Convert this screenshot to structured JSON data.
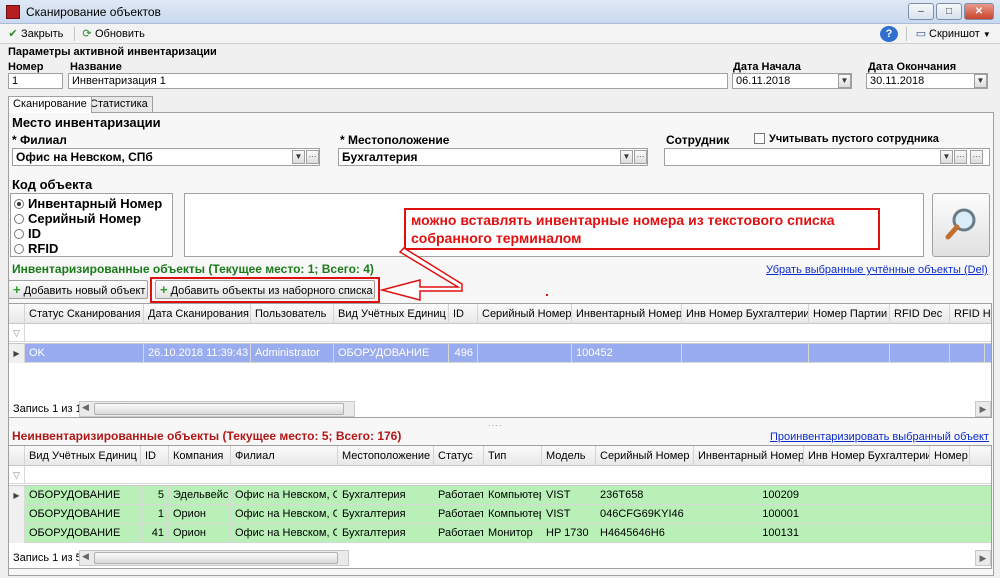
{
  "window": {
    "title": "Сканирование объектов",
    "min": "‒",
    "max": "□",
    "close": "✕"
  },
  "toolbar": {
    "close": "Закрыть",
    "refresh": "Обновить",
    "help": "?",
    "screenshot": "Скриншот"
  },
  "params": {
    "section": "Параметры активной инвентаризации",
    "number_label": "Номер",
    "number": "1",
    "name_label": "Название",
    "name": "Инвентаризация 1",
    "start_label": "Дата Начала",
    "start": "06.11.2018",
    "end_label": "Дата Окончания",
    "end": "30.11.2018"
  },
  "tabs": [
    "Сканирование",
    "Статистика"
  ],
  "place": {
    "title": "Место инвентаризации",
    "branch_label": "* Филиал",
    "branch": "Офис на Невском, СПб",
    "location_label": "* Местоположение",
    "location": "Бухгалтерия",
    "employee_label": "Сотрудник",
    "empty_emp": "Учитывать пустого сотрудника",
    "ellipsis": "···"
  },
  "code": {
    "title": "Код объекта",
    "options": [
      "Инвентарный Номер",
      "Серийный Номер",
      "ID",
      "RFID"
    ]
  },
  "annotation": "можно вставлять инвентарные номера из текстового списка собранного терминалом",
  "inv": {
    "title": "Инвентаризированные объекты (Текущее место: 1; Всего: 4)",
    "remove_link": "Убрать выбранные учтённые объекты (Del)",
    "add_new": "Добавить новый объект",
    "add_list": "Добавить объекты из наборного списка",
    "columns": [
      "Статус Сканирования",
      "Дата Сканирования",
      "Пользователь",
      "Вид Учётных Единиц",
      "ID",
      "Серийный Номер",
      "Инвентарный Номер",
      "Инв Номер Бухгалтерии",
      "Номер Партии",
      "RFID Dec",
      "RFID Hex"
    ],
    "rows": [
      [
        "OK",
        "26.10.2018 11:39:43",
        "Administrator",
        "ОБОРУДОВАНИЕ",
        "496",
        "",
        "100452",
        "",
        "",
        "",
        ""
      ]
    ],
    "record": "Запись 1 из 1"
  },
  "noninv": {
    "title": "Неинвентаризированные объекты (Текущее место: 5; Всего: 176)",
    "link": "Проинвентаризировать выбранный объект",
    "columns": [
      "Вид Учётных Единиц",
      "ID",
      "Компания",
      "Филиал",
      "Местоположение",
      "Статус",
      "Тип",
      "Модель",
      "Серийный Номер",
      "Инвентарный Номер",
      "Инв Номер Бухгалтерии",
      "Номер Партии"
    ],
    "rows": [
      [
        "ОБОРУДОВАНИЕ",
        "5",
        "Эдельвейс",
        "Офис на Невском, СПб",
        "Бухгалтерия",
        "Работает",
        "Компьютер",
        "VIST",
        "236T658",
        "100209",
        "",
        ""
      ],
      [
        "ОБОРУДОВАНИЕ",
        "1",
        "Орион",
        "Офис на Невском, СПб",
        "Бухгалтерия",
        "Работает",
        "Компьютер",
        "VIST",
        "046CFG69KYI46",
        "100001",
        "",
        ""
      ],
      [
        "ОБОРУДОВАНИЕ",
        "41",
        "Орион",
        "Офис на Невском, СПб",
        "Бухгалтерия",
        "Работает",
        "Монитор",
        "HP 1730",
        "H4645646H6",
        "100131",
        "",
        ""
      ]
    ],
    "record": "Запись 1 из 5"
  },
  "colors": {
    "selected_row": "#9aacf0",
    "green_row": "#b8f0b8",
    "inv_title": "#1a7a1a",
    "noninv_title": "#b01818",
    "annotation": "#e01010"
  }
}
